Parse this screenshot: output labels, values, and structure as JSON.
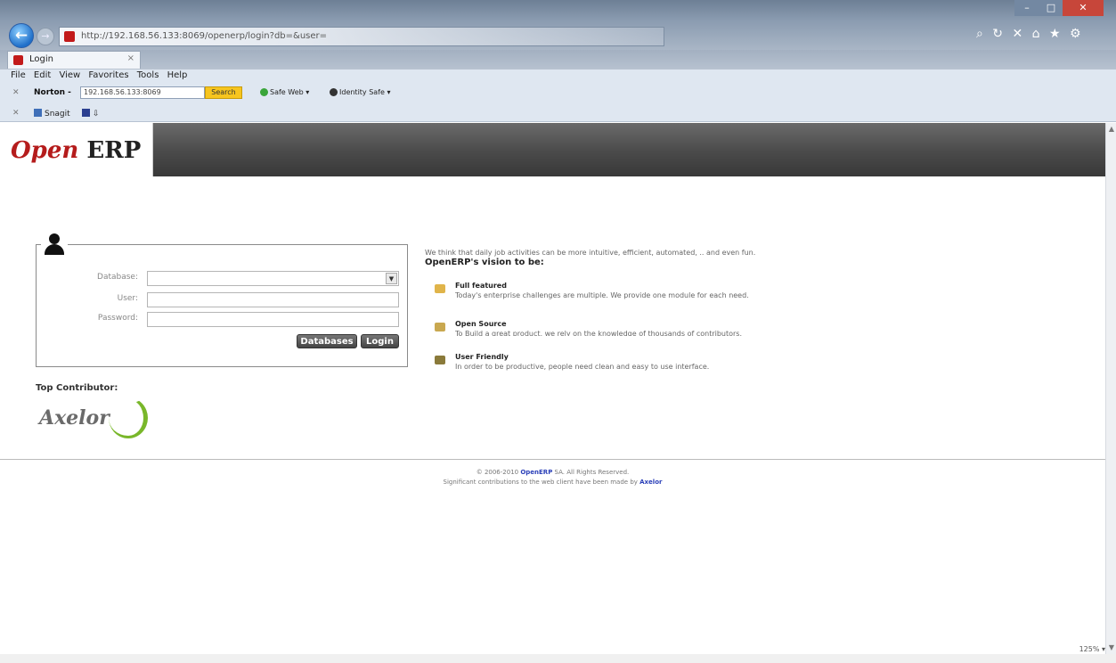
{
  "browser": {
    "address_url": "http://192.168.56.133:8069/openerp/login?db=&user=",
    "address_domain": "192.168.56.133",
    "tab_title": "Login",
    "menu": [
      "File",
      "Edit",
      "View",
      "Favorites",
      "Tools",
      "Help"
    ],
    "norton_label": "Norton -",
    "norton_search_value": "192.168.56.133:8069",
    "norton_search_button": "Search",
    "safe_web": "Safe Web ▾",
    "identity_safe": "Identity Safe ▾",
    "snagit": "Snagit",
    "snagit2": "⇩",
    "zoom": "125%"
  },
  "app": {
    "logo_open": "Open",
    "logo_erp": "ERP"
  },
  "login": {
    "database_label": "Database:",
    "user_label": "User:",
    "password_label": "Password:",
    "databases_button": "Databases",
    "login_button": "Login"
  },
  "top_contributor": {
    "label": "Top Contributor:",
    "logo_text": "Axelor"
  },
  "vision": {
    "intro": "We think that daily job activities can be more intuitive, efficient, automated, .. and even fun.",
    "title": "OpenERP's vision to be:",
    "features": [
      {
        "title": "Full featured",
        "desc": "Today's enterprise challenges are multiple. We provide one module for each need."
      },
      {
        "title": "Open Source",
        "desc": "To Build a great product, we rely on the knowledge of thousands of contributors."
      },
      {
        "title": "User Friendly",
        "desc": "In order to be productive, people need clean and easy to use interface."
      }
    ]
  },
  "footer": {
    "line1_prefix": "© 2006-2010 ",
    "line1_link": "OpenERP",
    "line1_suffix": " SA. All Rights Reserved.",
    "line2_prefix": "Significant contributions to the web client have been made by ",
    "line2_link": "Axelor"
  },
  "colors": {
    "brand_red": "#b51c1c",
    "header_dark": "#4a4a4a",
    "axelor_green": "#79b72a",
    "link_blue": "#2a3fb8"
  }
}
